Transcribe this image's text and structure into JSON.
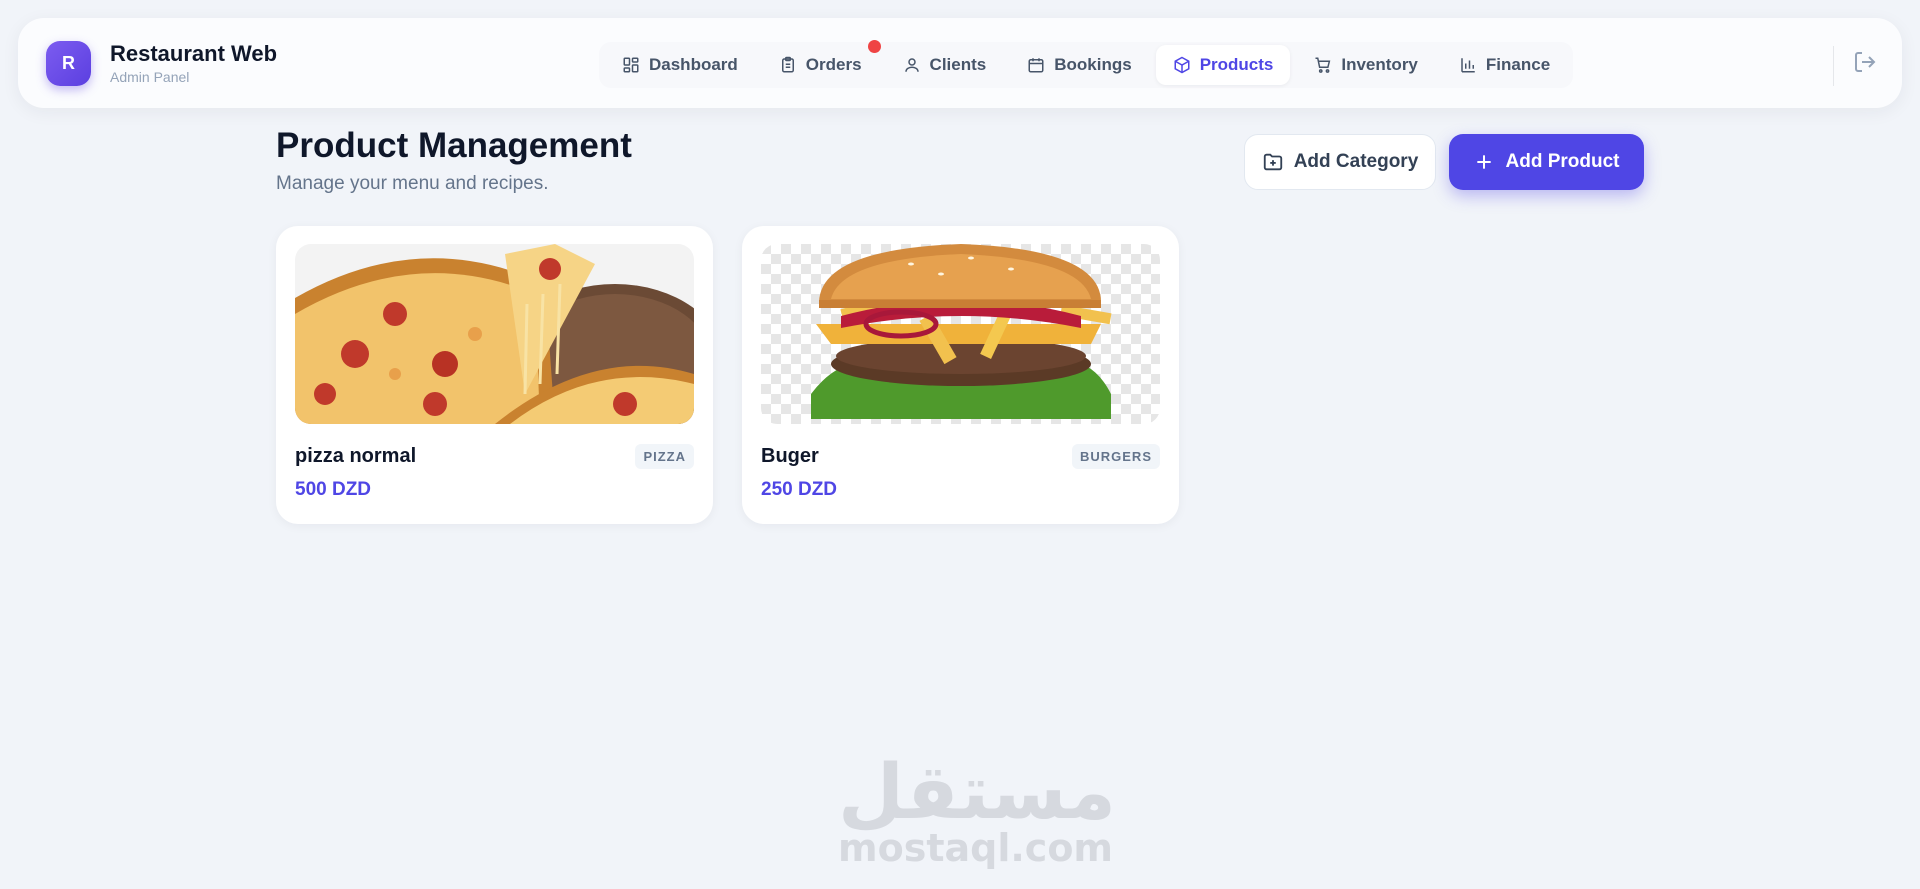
{
  "brand": {
    "logo_letter": "R",
    "title": "Restaurant Web",
    "subtitle": "Admin Panel"
  },
  "nav": {
    "items": [
      {
        "label": "Dashboard",
        "icon": "grid-icon",
        "active": false
      },
      {
        "label": "Orders",
        "icon": "clipboard-icon",
        "active": false,
        "notification": true
      },
      {
        "label": "Clients",
        "icon": "user-icon",
        "active": false
      },
      {
        "label": "Bookings",
        "icon": "calendar-icon",
        "active": false
      },
      {
        "label": "Products",
        "icon": "box-icon",
        "active": true
      },
      {
        "label": "Inventory",
        "icon": "cart-icon",
        "active": false
      },
      {
        "label": "Finance",
        "icon": "bar-chart-icon",
        "active": false
      }
    ],
    "logout_icon": "logout-icon"
  },
  "page": {
    "title": "Product Management",
    "subtitle": "Manage your menu and recipes."
  },
  "actions": {
    "add_category": "Add Category",
    "add_product": "Add Product"
  },
  "products": [
    {
      "name": "pizza normal",
      "category": "PIZZA",
      "price": "500 DZD",
      "image": "pizza-photo"
    },
    {
      "name": "Buger",
      "category": "BURGERS",
      "price": "250 DZD",
      "image": "burger-photo"
    }
  ],
  "watermark": {
    "arabic": "مستقل",
    "latin": "mostaql.com"
  },
  "colors": {
    "accent": "#4f46e5",
    "badge_bg": "#f1f5f9",
    "notification": "#ef4444",
    "background": "#f1f4f9"
  }
}
